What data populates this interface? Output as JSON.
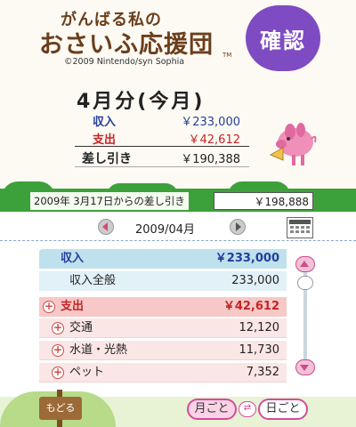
{
  "header": {
    "logo_line1": "がんばる私の",
    "logo_line2": "おさいふ応援団",
    "tm": "TM",
    "copyright": "©2009  Nintendo/syn Sophia",
    "confirm_label": "確認"
  },
  "summary": {
    "month_title": "4月分(今月)",
    "income_label": "収入",
    "income_value": "￥233,000",
    "expense_label": "支出",
    "expense_value": "￥42,612",
    "diff_label": "差し引き",
    "diff_value": "￥190,388"
  },
  "banner": {
    "text": "2009年 3月17日からの差し引き",
    "value": "￥198,888"
  },
  "month_nav": {
    "label": "2009/04月"
  },
  "list": {
    "income": {
      "label": "収入",
      "value": "￥233,000"
    },
    "income_items": [
      {
        "label": "収入全般",
        "value": "233,000"
      }
    ],
    "expense": {
      "label": "支出",
      "value": "￥42,612"
    },
    "expense_items": [
      {
        "label": "交通",
        "value": "12,120"
      },
      {
        "label": "水道・光熱",
        "value": "11,730"
      },
      {
        "label": "ペット",
        "value": "7,352"
      }
    ]
  },
  "footer": {
    "back_label": "もどる",
    "monthly_label": "月ごと",
    "daily_label": "日ごと"
  },
  "colors": {
    "accent_purple": "#7e4bc3",
    "income_blue": "#233e9c",
    "expense_red": "#c42424",
    "banner_green": "#3da13b",
    "toggle_pink": "#d44c95"
  }
}
